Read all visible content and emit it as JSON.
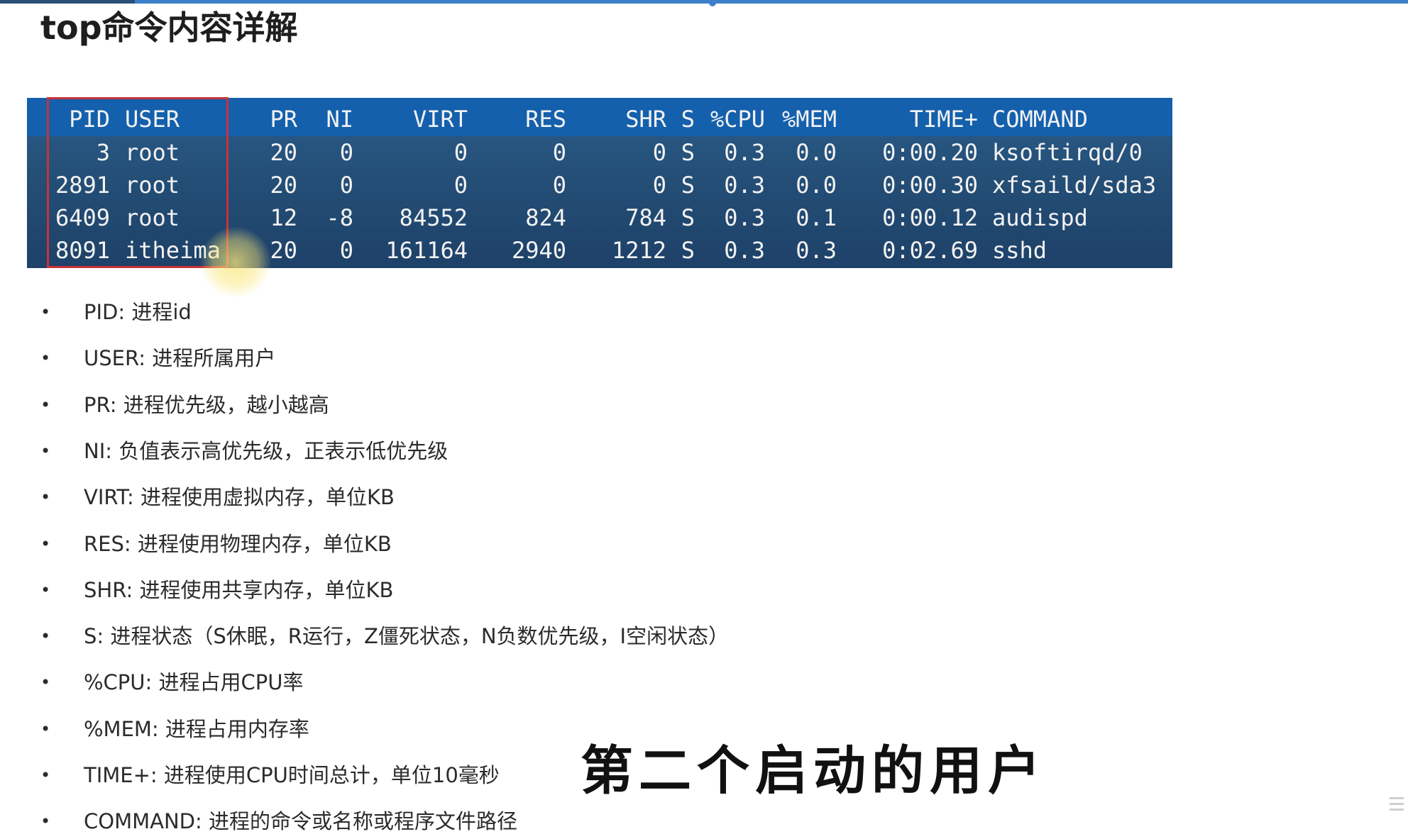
{
  "page": {
    "title": "top命令内容详解"
  },
  "colors": {
    "table_bg": "#244f77",
    "header_bg": "#1460ad",
    "highlight_border": "#c8323a",
    "progress": "#3d7fc9"
  },
  "table": {
    "headers": [
      "PID",
      "USER",
      "PR",
      "NI",
      "VIRT",
      "RES",
      "SHR",
      "S",
      "%CPU",
      "%MEM",
      "TIME+",
      "COMMAND"
    ],
    "rows": [
      [
        "3",
        "root",
        "20",
        "0",
        "0",
        "0",
        "0",
        "S",
        "0.3",
        "0.0",
        "0:00.20",
        "ksoftirqd/0"
      ],
      [
        "2891",
        "root",
        "20",
        "0",
        "0",
        "0",
        "0",
        "S",
        "0.3",
        "0.0",
        "0:00.30",
        "xfsaild/sda3"
      ],
      [
        "6409",
        "root",
        "12",
        "-8",
        "84552",
        "824",
        "784",
        "S",
        "0.3",
        "0.1",
        "0:00.12",
        "audispd"
      ],
      [
        "8091",
        "itheima",
        "20",
        "0",
        "161164",
        "2940",
        "1212",
        "S",
        "0.3",
        "0.3",
        "0:02.69",
        "sshd"
      ]
    ]
  },
  "bullets": [
    "PID: 进程id",
    "USER: 进程所属用户",
    "PR: 进程优先级，越小越高",
    "NI: 负值表示高优先级，正表示低优先级",
    "VIRT: 进程使用虚拟内存，单位KB",
    "RES: 进程使用物理内存，单位KB",
    "SHR: 进程使用共享内存，单位KB",
    "S: 进程状态（S休眠，R运行，Z僵死状态，N负数优先级，I空闲状态）",
    "%CPU: 进程占用CPU率",
    "%MEM: 进程占用内存率",
    "TIME+: 进程使用CPU时间总计，单位10毫秒",
    "COMMAND: 进程的命令或名称或程序文件路径"
  ],
  "subtitle": "第二个启动的用户"
}
